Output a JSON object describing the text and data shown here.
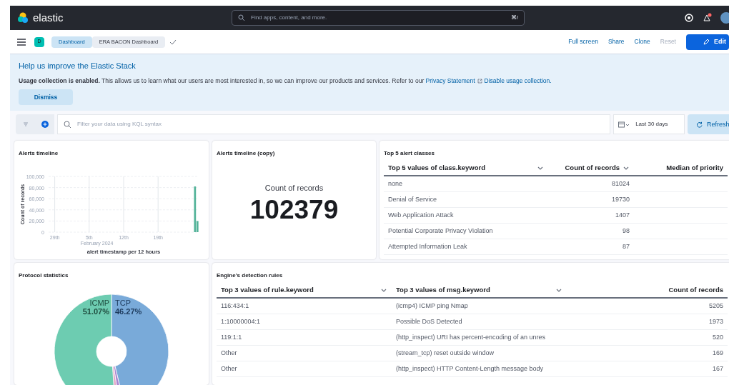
{
  "header": {
    "logo": "elastic",
    "search": {
      "placeholder": "Find apps, content, and more.",
      "shortcut": "⌘/"
    }
  },
  "nav": {
    "space": "D",
    "breadcrumbs": [
      {
        "label": "Dashboard",
        "selected": false
      },
      {
        "label": "ERA BACON Dashboard",
        "selected": true
      }
    ],
    "actions": [
      {
        "label": "Full screen",
        "disabled": false
      },
      {
        "label": "Share",
        "disabled": false
      },
      {
        "label": "Clone",
        "disabled": false
      },
      {
        "label": "Reset",
        "disabled": true
      }
    ],
    "edit": "Edit"
  },
  "banner": {
    "title": "Help us improve the Elastic Stack",
    "text": "**Usage collection is enabled.** This allows us to learn what our users are most interested in, so we can improve our products and services. Refer to our",
    "link": "Privacy Statement",
    "link2": "Disable usage collection.",
    "dismiss": "Dismiss"
  },
  "filter": {
    "placeholder": "Filter your data using KQL syntax",
    "range": "Last 30 days",
    "refresh": "Refresh"
  },
  "panels": [
    {
      "kind": "timeline",
      "title": "Alerts timeline",
      "date_label": "February 2024",
      "chart_data": {
        "type": "bar",
        "xlabel": "alert timestamp per 12 hours",
        "ylabel": "Count of records",
        "categories": [
          null,
          null,
          "29th",
          null,
          null,
          null,
          null,
          null,
          null,
          null,
          null,
          null,
          null,
          null,
          null,
          null,
          "5th",
          null,
          null,
          null,
          null,
          null,
          null,
          null,
          null,
          null,
          null,
          null,
          null,
          null,
          "12th",
          null,
          null,
          null,
          null,
          null,
          null,
          null,
          null,
          null,
          null,
          null,
          null,
          null,
          "19th",
          null,
          null,
          null,
          null,
          null,
          null,
          null,
          null,
          null,
          null,
          null,
          null,
          null,
          null,
          null,
          null
        ],
        "values": [
          null,
          null,
          null,
          null,
          null,
          null,
          null,
          null,
          null,
          null,
          null,
          null,
          null,
          null,
          null,
          null,
          null,
          null,
          null,
          null,
          null,
          null,
          null,
          null,
          null,
          null,
          null,
          null,
          null,
          null,
          null,
          null,
          null,
          null,
          null,
          null,
          null,
          null,
          null,
          null,
          null,
          null,
          null,
          null,
          null,
          null,
          null,
          null,
          null,
          null,
          null,
          null,
          null,
          null,
          null,
          null,
          null,
          null,
          null,
          82000,
          20000
        ],
        "ylim": [
          0,
          100000
        ],
        "grid": true,
        "yticks": [
          {
            "value": 0,
            "label": "0"
          },
          {
            "value": 20000,
            "label": "20,000"
          },
          {
            "value": 40000,
            "label": "40,000"
          },
          {
            "value": 60000,
            "label": "60,000"
          },
          {
            "value": 80000,
            "label": "80,000"
          },
          {
            "value": 100000,
            "label": "100,000"
          }
        ],
        "color": "#54b399"
      }
    },
    {
      "kind": "metric",
      "title": "Alerts timeline (copy)",
      "label": "Count of records",
      "value": "102379"
    },
    {
      "kind": "table",
      "title": "Top 5 alert classes",
      "columns": [
        "Top 5 values of class.keyword",
        "Count of records",
        "Median of priority"
      ],
      "rows": [
        [
          "none",
          "81024"
        ],
        [
          "Denial of Service",
          "19730"
        ],
        [
          "Web Application Attack",
          "1407"
        ],
        [
          "Potential Corporate Privacy Violation",
          "98"
        ],
        [
          "Attempted Information Leak",
          "87"
        ]
      ]
    },
    {
      "kind": "pie",
      "title": "Protocol statistics",
      "chart_data": {
        "type": "donut",
        "categories": [
          "ICMP",
          "TCP",
          null,
          null
        ],
        "values": [
          51.07,
          46.27,
          1.4,
          1.26
        ],
        "colors": [
          "#6dccb1",
          "#79aad9",
          "#a987d1",
          "#e4a6c7"
        ],
        "value_labels": [
          "51.07%",
          "46.27%",
          null,
          null
        ]
      }
    },
    {
      "kind": "table",
      "title": "Engine's detection rules",
      "columns": [
        "Top 3 values of rule.keyword",
        "Top 3 values of msg.keyword",
        "Count of records"
      ],
      "rows": [
        [
          "116:434:1",
          "(icmp4) ICMP ping Nmap",
          "5205"
        ],
        [
          "1:10000004:1",
          "Possible DoS Detected",
          "1973"
        ],
        [
          "119:1:1",
          "(http_inspect) URI has percent-encoding of an unres",
          "520"
        ],
        [
          "Other",
          "(stream_tcp) reset outside window",
          "169"
        ],
        [
          "Other",
          "(http_inspect) HTTP Content-Length message body",
          "167"
        ]
      ]
    }
  ]
}
